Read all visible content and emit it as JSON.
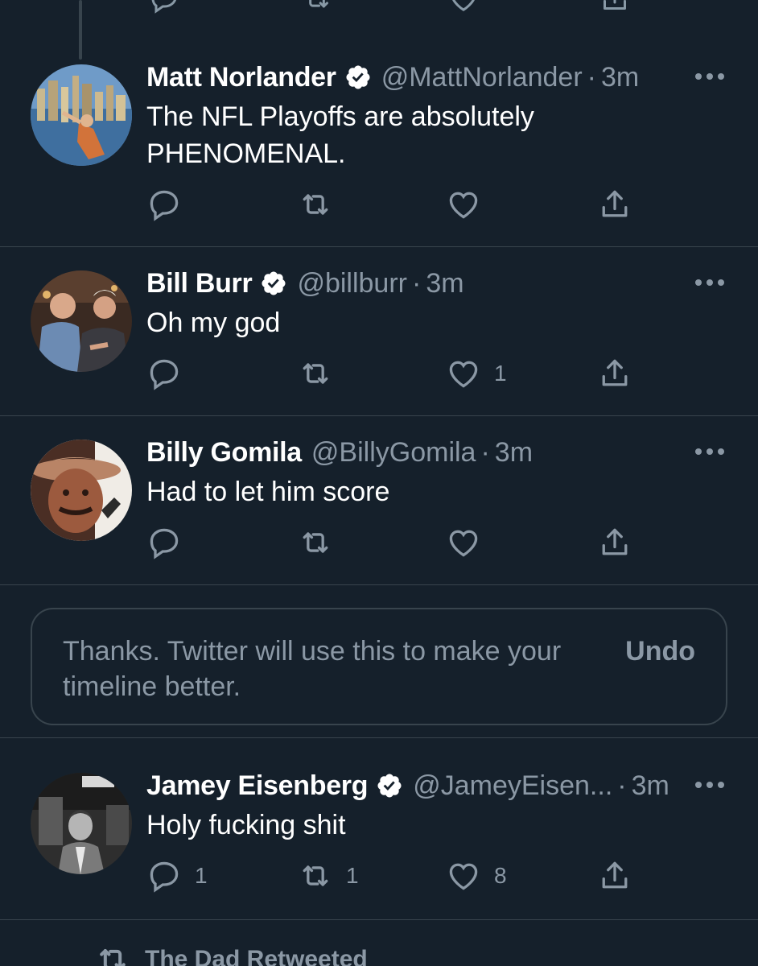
{
  "tweets": [
    {
      "name": "Matt Norlander",
      "verified": true,
      "handle": "@MattNorlander",
      "separator": "·",
      "time": "3m",
      "text_lines": [
        "The NFL Playoffs are absolutely",
        "PHENOMENAL."
      ],
      "counts": {
        "reply": "",
        "retweet": "",
        "like": ""
      },
      "avatar_icon": "avatar-photo"
    },
    {
      "name": "Bill Burr",
      "verified": true,
      "handle": "@billburr",
      "separator": "·",
      "time": "3m",
      "text_lines": [
        "Oh my god"
      ],
      "counts": {
        "reply": "",
        "retweet": "",
        "like": "1"
      },
      "avatar_icon": "avatar-photo"
    },
    {
      "name": "Billy Gomila",
      "verified": false,
      "handle": "@BillyGomila",
      "separator": "·",
      "time": "3m",
      "text_lines": [
        "Had to let him score"
      ],
      "counts": {
        "reply": "",
        "retweet": "",
        "like": ""
      },
      "avatar_icon": "avatar-photo"
    },
    {
      "name": "Jamey Eisenberg",
      "verified": true,
      "handle": "@JameyEisen...",
      "separator": "·",
      "time": "3m",
      "text_lines": [
        "Holy fucking shit"
      ],
      "counts": {
        "reply": "1",
        "retweet": "1",
        "like": "8"
      },
      "avatar_icon": "avatar-photo"
    }
  ],
  "feedback": {
    "text_line1": "Thanks. Twitter will use this to make your",
    "text_line2": "timeline better.",
    "undo_label": "Undo"
  },
  "retweeted_label": "The Dad Retweeted",
  "icons": {
    "reply": "reply-icon",
    "retweet": "retweet-icon",
    "like": "heart-icon",
    "share": "share-icon",
    "more": "more-options-icon",
    "verified": "verified-badge-icon"
  },
  "colors": {
    "background": "#15202b",
    "text": "#ffffff",
    "secondary": "#8b98a5",
    "border": "#38444d"
  }
}
